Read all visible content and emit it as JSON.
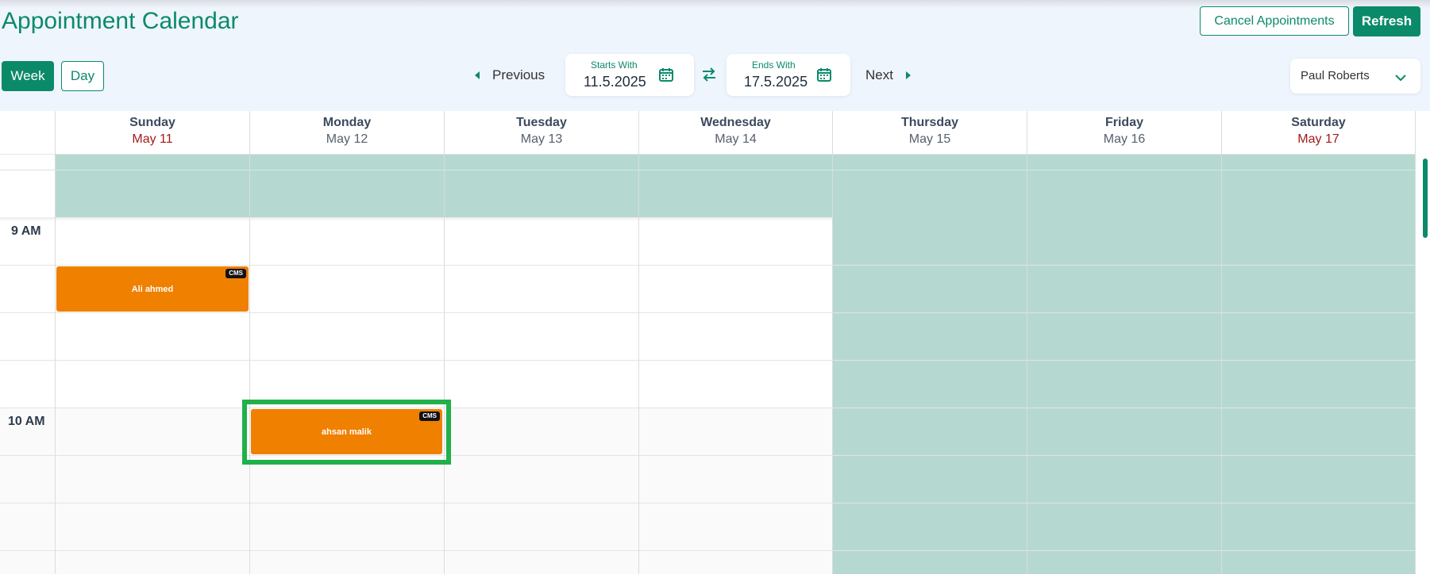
{
  "header": {
    "title": "Appointment Calendar",
    "cancel_label": "Cancel Appointments",
    "refresh_label": "Refresh"
  },
  "view_toggle": {
    "week_label": "Week",
    "day_label": "Day",
    "active": "Week"
  },
  "date_nav": {
    "previous_label": "Previous",
    "next_label": "Next",
    "start": {
      "label": "Starts With",
      "value": "11.5.2025"
    },
    "end": {
      "label": "Ends With",
      "value": "17.5.2025"
    }
  },
  "user": {
    "selected": "Paul Roberts"
  },
  "colors": {
    "brand": "#0b8a6a",
    "unavailable": "#b5d9d1",
    "appointment": "#f08000",
    "weekend_date": "#a21a1a",
    "highlight": "#21b04b"
  },
  "calendar": {
    "days": [
      {
        "name": "Sunday",
        "date": "May 11",
        "weekend": true
      },
      {
        "name": "Monday",
        "date": "May 12",
        "weekend": false
      },
      {
        "name": "Tuesday",
        "date": "May 13",
        "weekend": false
      },
      {
        "name": "Wednesday",
        "date": "May 14",
        "weekend": false
      },
      {
        "name": "Thursday",
        "date": "May 15",
        "weekend": false
      },
      {
        "name": "Friday",
        "date": "May 16",
        "weekend": false
      },
      {
        "name": "Saturday",
        "date": "May 17",
        "weekend": true
      }
    ],
    "time_labels": [
      "9 AM",
      "10 AM"
    ],
    "appointments": [
      {
        "name": "Ali ahmed",
        "tag": "CMS",
        "day": "Sunday"
      },
      {
        "name": "ahsan malik",
        "tag": "CMS",
        "day": "Monday"
      }
    ]
  }
}
